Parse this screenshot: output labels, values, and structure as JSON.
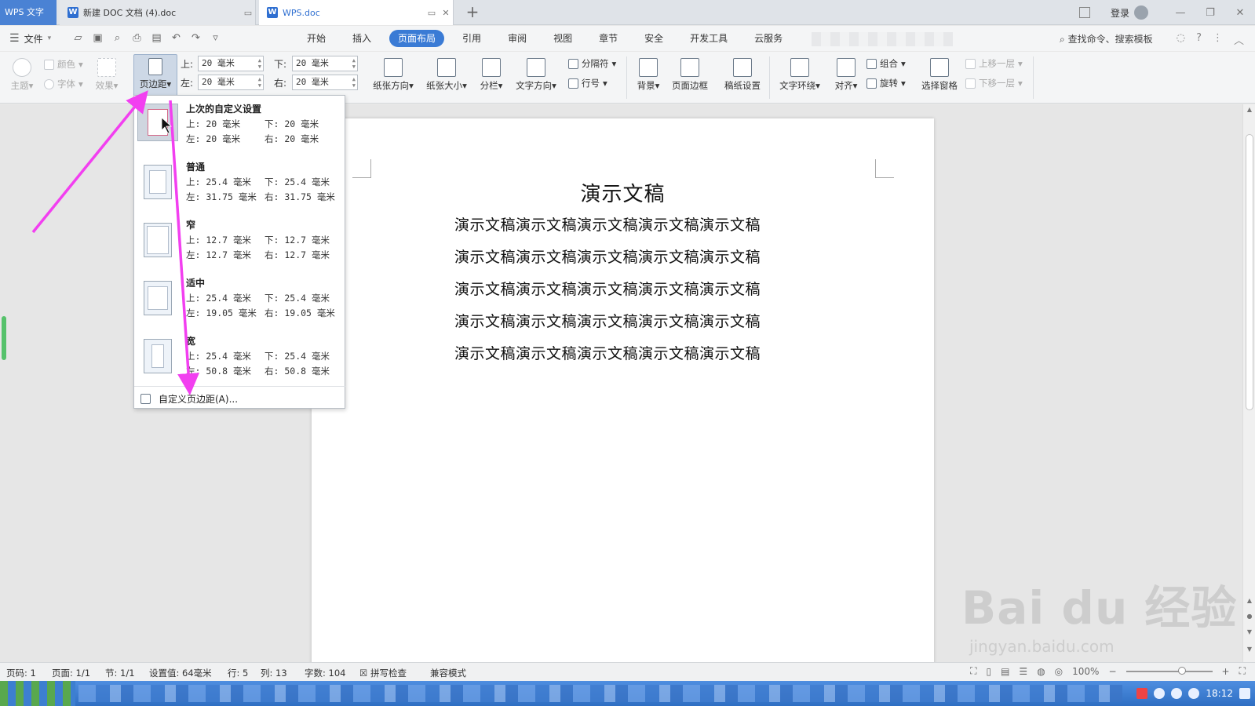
{
  "titlebar": {
    "app_name": "WPS 文字",
    "tabs": [
      {
        "label": "新建 DOC 文档 (4).doc",
        "active": false
      },
      {
        "label": "WPS.doc",
        "active": true
      }
    ],
    "login": "登录"
  },
  "menubar": {
    "file_label": "文件",
    "tabs": [
      "开始",
      "插入",
      "页面布局",
      "引用",
      "审阅",
      "视图",
      "章节",
      "安全",
      "开发工具",
      "云服务"
    ],
    "active_tab": "页面布局",
    "search_label": "查找命令、搜索模板"
  },
  "ribbon": {
    "theme_label": "主题",
    "color_label": "颜色",
    "font_label": "字体",
    "effect_label": "效果",
    "margins_label": "页边距",
    "margin_top_label": "上:",
    "margin_top_value": "20 毫米",
    "margin_bottom_label": "下:",
    "margin_bottom_value": "20 毫米",
    "margin_left_label": "左:",
    "margin_left_value": "20 毫米",
    "margin_right_label": "右:",
    "margin_right_value": "20 毫米",
    "orientation_label": "纸张方向",
    "size_label": "纸张大小",
    "columns_label": "分栏",
    "text_dir_label": "文字方向",
    "breaks_label": "分隔符",
    "line_num_label": "行号",
    "background_label": "背景",
    "page_border_label": "页面边框",
    "draft_label": "稿纸设置",
    "wrap_label": "文字环绕",
    "align_label": "对齐",
    "group_label": "组合",
    "rotate_label": "旋转",
    "selection_pane_label": "选择窗格",
    "bring_forward_label": "上移一层",
    "send_backward_label": "下移一层"
  },
  "margin_dropdown": {
    "presets": [
      {
        "name": "上次的自定义设置",
        "top": "上: 20 毫米",
        "bottom": "下: 20 毫米",
        "left": "左: 20 毫米",
        "right": "右: 20 毫米"
      },
      {
        "name": "普通",
        "top": "上: 25.4 毫米",
        "bottom": "下: 25.4 毫米",
        "left": "左: 31.75 毫米",
        "right": "右: 31.75 毫米"
      },
      {
        "name": "窄",
        "top": "上: 12.7 毫米",
        "bottom": "下: 12.7 毫米",
        "left": "左: 12.7 毫米",
        "right": "右: 12.7 毫米"
      },
      {
        "name": "适中",
        "top": "上: 25.4 毫米",
        "bottom": "下: 25.4 毫米",
        "left": "左: 19.05 毫米",
        "right": "右: 19.05 毫米"
      },
      {
        "name": "宽",
        "top": "上: 25.4 毫米",
        "bottom": "下: 25.4 毫米",
        "left": "左: 50.8 毫米",
        "right": "右: 50.8 毫米"
      }
    ],
    "custom_label": "自定义页边距(A)..."
  },
  "document": {
    "title": "演示文稿",
    "lines": [
      "演示文稿演示文稿演示文稿演示文稿演示文稿",
      "演示文稿演示文稿演示文稿演示文稿演示文稿",
      "演示文稿演示文稿演示文稿演示文稿演示文稿",
      "演示文稿演示文稿演示文稿演示文稿演示文稿",
      "演示文稿演示文稿演示文稿演示文稿演示文稿"
    ]
  },
  "statusbar": {
    "page_num": "页码: 1",
    "pages": "页面: 1/1",
    "section": "节: 1/1",
    "setting": "设置值: 64毫米",
    "row": "行: 5",
    "col": "列: 13",
    "word_count": "字数: 104",
    "spell_check": "拼写检查",
    "compat_mode": "兼容模式",
    "zoom": "100%"
  },
  "taskbar": {
    "time": "18:12"
  },
  "watermark": {
    "brand": "Bai du 经验",
    "url": "jingyan.baidu.com"
  },
  "colors": {
    "accent": "#3a7bd5",
    "annotation_arrow": "#f23ff0"
  }
}
